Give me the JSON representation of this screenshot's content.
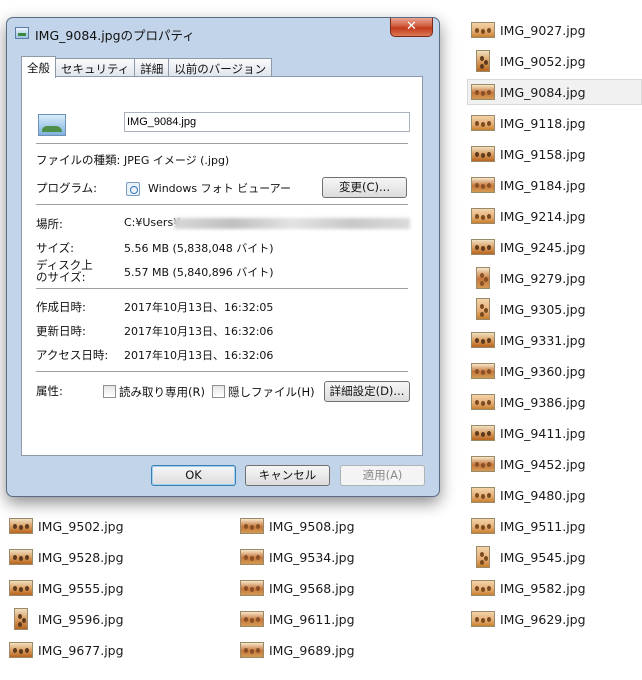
{
  "explorer": {
    "files": [
      {
        "name": "IMG_9027.jpg",
        "state": "normal",
        "thumb": "landscape"
      },
      {
        "name": "IMG_9052.jpg",
        "state": "normal",
        "thumb": "portrait"
      },
      {
        "name": "IMG_9084.jpg",
        "state": "selected",
        "thumb": "landscape"
      },
      {
        "name": "IMG_9118.jpg",
        "state": "normal",
        "thumb": "landscape"
      },
      {
        "name": "IMG_9158.jpg",
        "state": "normal",
        "thumb": "landscape"
      },
      {
        "name": "IMG_9184.jpg",
        "state": "normal",
        "thumb": "landscape"
      },
      {
        "name": "IMG_9214.jpg",
        "state": "normal",
        "thumb": "landscape"
      },
      {
        "name": "IMG_9245.jpg",
        "state": "normal",
        "thumb": "landscape"
      },
      {
        "name": "IMG_9279.jpg",
        "state": "normal",
        "thumb": "portrait"
      },
      {
        "name": "IMG_9305.jpg",
        "state": "normal",
        "thumb": "portrait"
      },
      {
        "name": "IMG_9331.jpg",
        "state": "normal",
        "thumb": "landscape"
      },
      {
        "name": "IMG_9360.jpg",
        "state": "normal",
        "thumb": "landscape"
      },
      {
        "name": "IMG_9386.jpg",
        "state": "normal",
        "thumb": "landscape"
      },
      {
        "name": "IMG_9411.jpg",
        "state": "normal",
        "thumb": "landscape"
      },
      {
        "name": "IMG_9452.jpg",
        "state": "normal",
        "thumb": "landscape"
      },
      {
        "name": "IMG_9480.jpg",
        "state": "normal",
        "thumb": "landscape"
      },
      {
        "name": "IMG_9502.jpg",
        "state": "normal",
        "thumb": "landscape"
      },
      {
        "name": "IMG_9508.jpg",
        "state": "normal",
        "thumb": "landscape"
      },
      {
        "name": "IMG_9511.jpg",
        "state": "normal",
        "thumb": "landscape"
      },
      {
        "name": "IMG_9528.jpg",
        "state": "normal",
        "thumb": "landscape"
      },
      {
        "name": "IMG_9534.jpg",
        "state": "normal",
        "thumb": "landscape"
      },
      {
        "name": "IMG_9545.jpg",
        "state": "normal",
        "thumb": "portrait"
      },
      {
        "name": "IMG_9555.jpg",
        "state": "normal",
        "thumb": "landscape"
      },
      {
        "name": "IMG_9568.jpg",
        "state": "normal",
        "thumb": "landscape"
      },
      {
        "name": "IMG_9582.jpg",
        "state": "normal",
        "thumb": "landscape"
      },
      {
        "name": "IMG_9596.jpg",
        "state": "normal",
        "thumb": "portrait"
      },
      {
        "name": "IMG_9611.jpg",
        "state": "normal",
        "thumb": "landscape"
      },
      {
        "name": "IMG_9629.jpg",
        "state": "normal",
        "thumb": "landscape"
      },
      {
        "name": "IMG_9677.jpg",
        "state": "normal",
        "thumb": "landscape"
      },
      {
        "name": "IMG_9689.jpg",
        "state": "normal",
        "thumb": "landscape"
      }
    ]
  },
  "dialog": {
    "title": "IMG_9084.jpgのプロパティ",
    "close_label": "✕",
    "tabs": [
      "全般",
      "セキュリティ",
      "詳細",
      "以前のバージョン"
    ],
    "active_tab": "全般",
    "file_name": "IMG_9084.jpg",
    "file_type_label": "ファイルの種類:",
    "file_type_value": "JPEG イメージ (.jpg)",
    "program_label": "プログラム:",
    "program_value": "Windows フォト ビューアー",
    "change_button": "変更(C)...",
    "location_label": "場所:",
    "location_value": "C:¥Users¥",
    "size_label": "サイズ:",
    "size_value": "5.56 MB (5,838,048 バイト)",
    "disk_size_label_1": "ディスク上",
    "disk_size_label_2": "のサイズ:",
    "disk_size_value": "5.57 MB (5,840,896 バイト)",
    "created_label": "作成日時:",
    "created_value": "2017年10月13日、16:32:05",
    "modified_label": "更新日時:",
    "modified_value": "2017年10月13日、16:32:06",
    "accessed_label": "アクセス日時:",
    "accessed_value": "2017年10月13日、16:32:06",
    "attributes_label": "属性:",
    "readonly_label": "読み取り専用(R)",
    "hidden_label": "隠しファイル(H)",
    "advanced_button": "詳細設定(D)...",
    "ok_button": "OK",
    "cancel_button": "キャンセル",
    "apply_button": "適用(A)"
  }
}
